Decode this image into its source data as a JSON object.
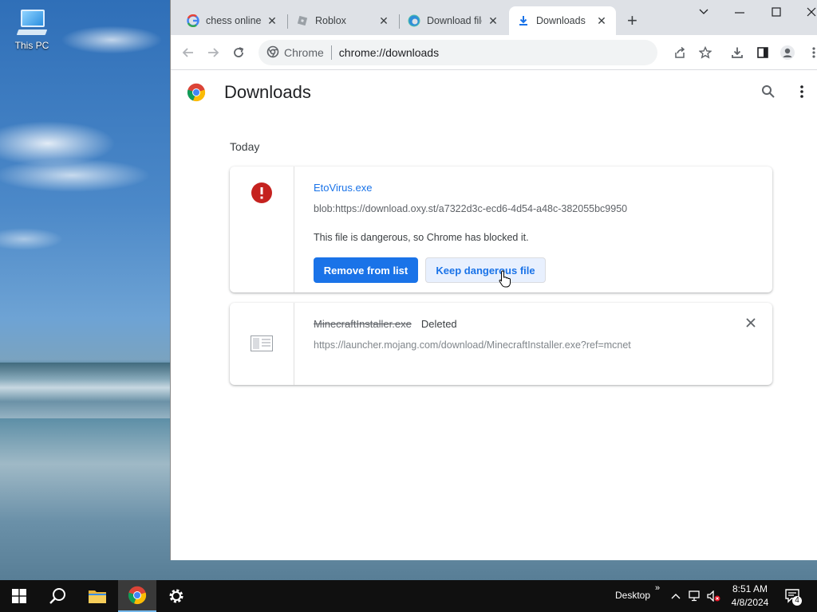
{
  "desktop": {
    "icons": [
      {
        "label": "This PC"
      }
    ]
  },
  "browser": {
    "tabs": [
      {
        "label": "chess online -",
        "icon": "google-icon",
        "active": false
      },
      {
        "label": "Roblox",
        "icon": "roblox-icon",
        "active": false
      },
      {
        "label": "Download file",
        "icon": "edge-icon",
        "active": false
      },
      {
        "label": "Downloads",
        "icon": "download-icon",
        "active": true
      }
    ],
    "new_tab_symbol": "+",
    "omnibox": {
      "site_label": "Chrome",
      "url": "chrome://downloads"
    }
  },
  "downloads_page": {
    "title": "Downloads",
    "section": "Today",
    "items": [
      {
        "filename": "EtoVirus.exe",
        "url": "blob:https://download.oxy.st/a7322d3c-ecd6-4d54-a48c-382055bc9950",
        "warning": "This file is dangerous, so Chrome has blocked it.",
        "primary_action": "Remove from list",
        "secondary_action": "Keep dangerous file",
        "status_icon": "error-icon"
      },
      {
        "filename": "MinecraftInstaller.exe",
        "status": "Deleted",
        "url": "https://launcher.mojang.com/download/MinecraftInstaller.exe?ref=mcnet",
        "status_icon": "file-icon"
      }
    ]
  },
  "taskbar": {
    "tray": {
      "desktop_label": "Desktop",
      "time": "8:51 AM",
      "date": "4/8/2024",
      "notification_count": "4"
    }
  },
  "colors": {
    "accent": "#1a73e8",
    "danger": "#c5221f",
    "taskbar": "#101010"
  }
}
